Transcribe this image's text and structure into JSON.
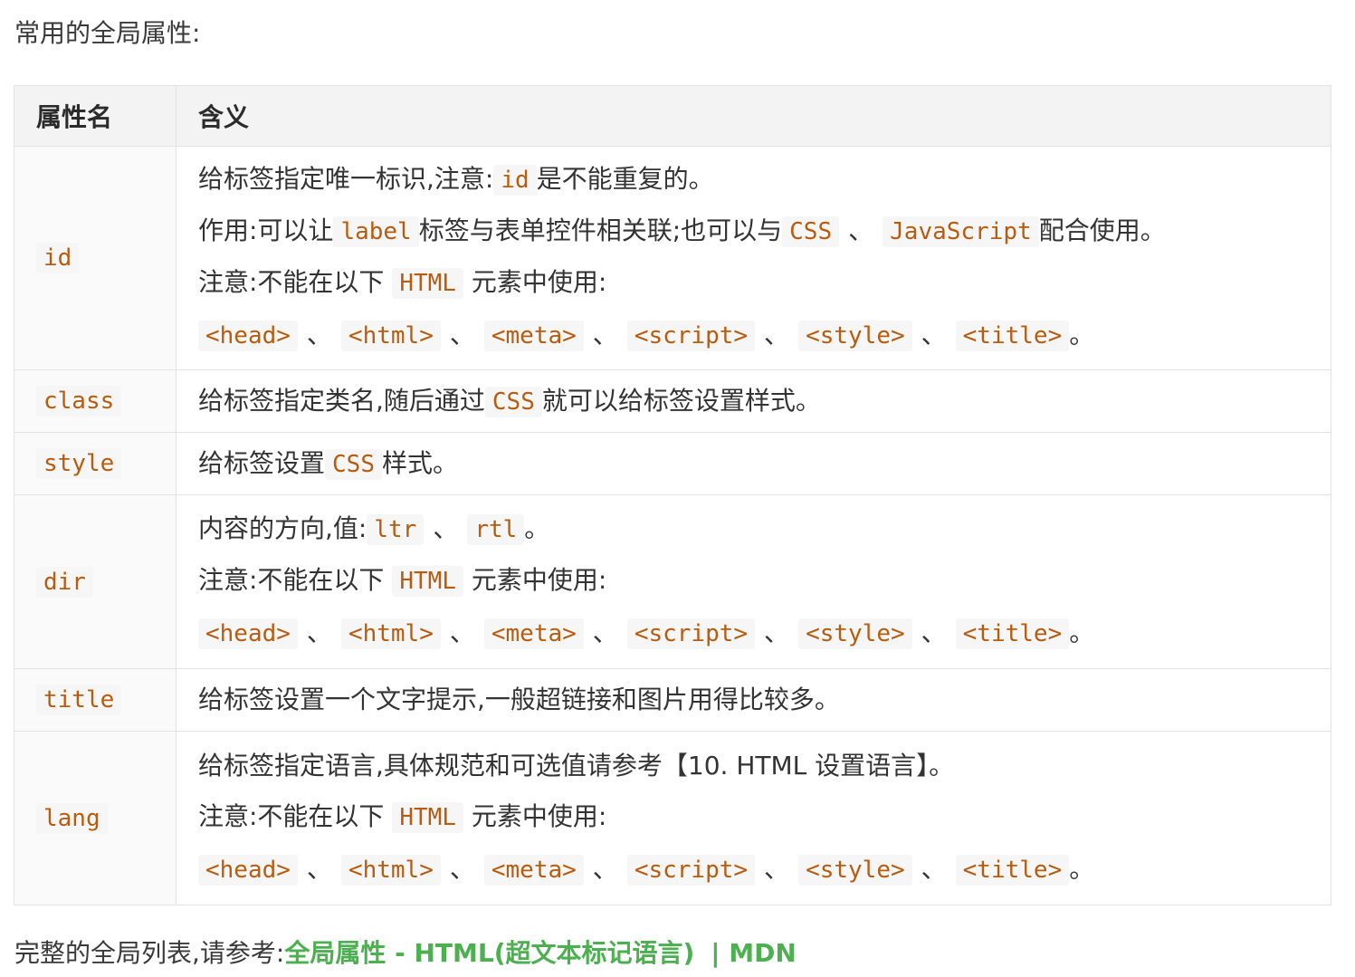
{
  "heading": "常用的全局属性:",
  "table": {
    "col_name": "属性名",
    "col_meaning": "含义",
    "tags": [
      "<head>",
      "<html>",
      "<meta>",
      "<script>",
      "<style>",
      "<title>"
    ],
    "sep": "、",
    "end": "。",
    "note_prefix": "注意:不能在以下",
    "note_html": "HTML",
    "note_suffix": "元素中使用:",
    "rows": {
      "id": {
        "name": "id",
        "l1_a": "给标签指定唯一标识,注意:",
        "l1_code": "id",
        "l1_b": "是不能重复的。",
        "l2_a": "作用:可以让",
        "l2_code1": "label",
        "l2_b": "标签与表单控件相关联;也可以与",
        "l2_code2": "CSS",
        "l2_sep": "、",
        "l2_code3": "JavaScript",
        "l2_c": "配合使用。"
      },
      "class": {
        "name": "class",
        "a": "给标签指定类名,随后通过",
        "code": "CSS",
        "b": "就可以给标签设置样式。"
      },
      "style": {
        "name": "style",
        "a": "给标签设置",
        "code": "CSS",
        "b": "样式。"
      },
      "dir": {
        "name": "dir",
        "a": "内容的方向,值:",
        "code1": "ltr",
        "sep": "、",
        "code2": "rtl",
        "end": "。"
      },
      "title": {
        "name": "title",
        "text": "给标签设置一个文字提示,一般超链接和图片用得比较多。"
      },
      "lang": {
        "name": "lang",
        "text": "给标签指定语言,具体规范和可选值请参考【10. HTML 设置语言】。"
      }
    }
  },
  "footer": {
    "text": "完整的全局列表,请参考:",
    "link": "全局属性 - HTML(超文本标记语言)",
    "mdn": "| MDN"
  }
}
